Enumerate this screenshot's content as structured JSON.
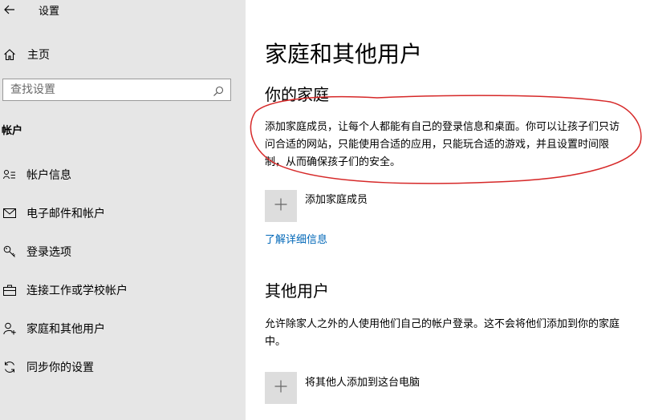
{
  "app": {
    "title": "设置",
    "back_icon": "back-arrow-icon"
  },
  "sidebar": {
    "home": {
      "label": "主页",
      "icon": "home-icon"
    },
    "search": {
      "placeholder": "查找设置",
      "icon": "search-icon"
    },
    "section_label": "帐户",
    "items": [
      {
        "label": "帐户信息",
        "icon": "person-card-icon"
      },
      {
        "label": "电子邮件和帐户",
        "icon": "mail-icon"
      },
      {
        "label": "登录选项",
        "icon": "key-icon"
      },
      {
        "label": "连接工作或学校帐户",
        "icon": "briefcase-icon"
      },
      {
        "label": "家庭和其他用户",
        "icon": "person-add-icon"
      },
      {
        "label": "同步你的设置",
        "icon": "sync-icon"
      }
    ]
  },
  "main": {
    "title": "家庭和其他用户",
    "family": {
      "heading": "你的家庭",
      "description": "添加家庭成员，让每个人都能有自己的登录信息和桌面。你可以让孩子们只访问合适的网站，只能使用合适的应用，只能玩合适的游戏，并且设置时间限制，从而确保孩子们的安全。",
      "add_label": "添加家庭成员",
      "learn_more": "了解详细信息"
    },
    "others": {
      "heading": "其他用户",
      "description": "允许除家人之外的人使用他们自己的帐户登录。这不会将他们添加到你的家庭中。",
      "add_label": "将其他人添加到这台电脑"
    },
    "annotation_color": "#d62828"
  }
}
